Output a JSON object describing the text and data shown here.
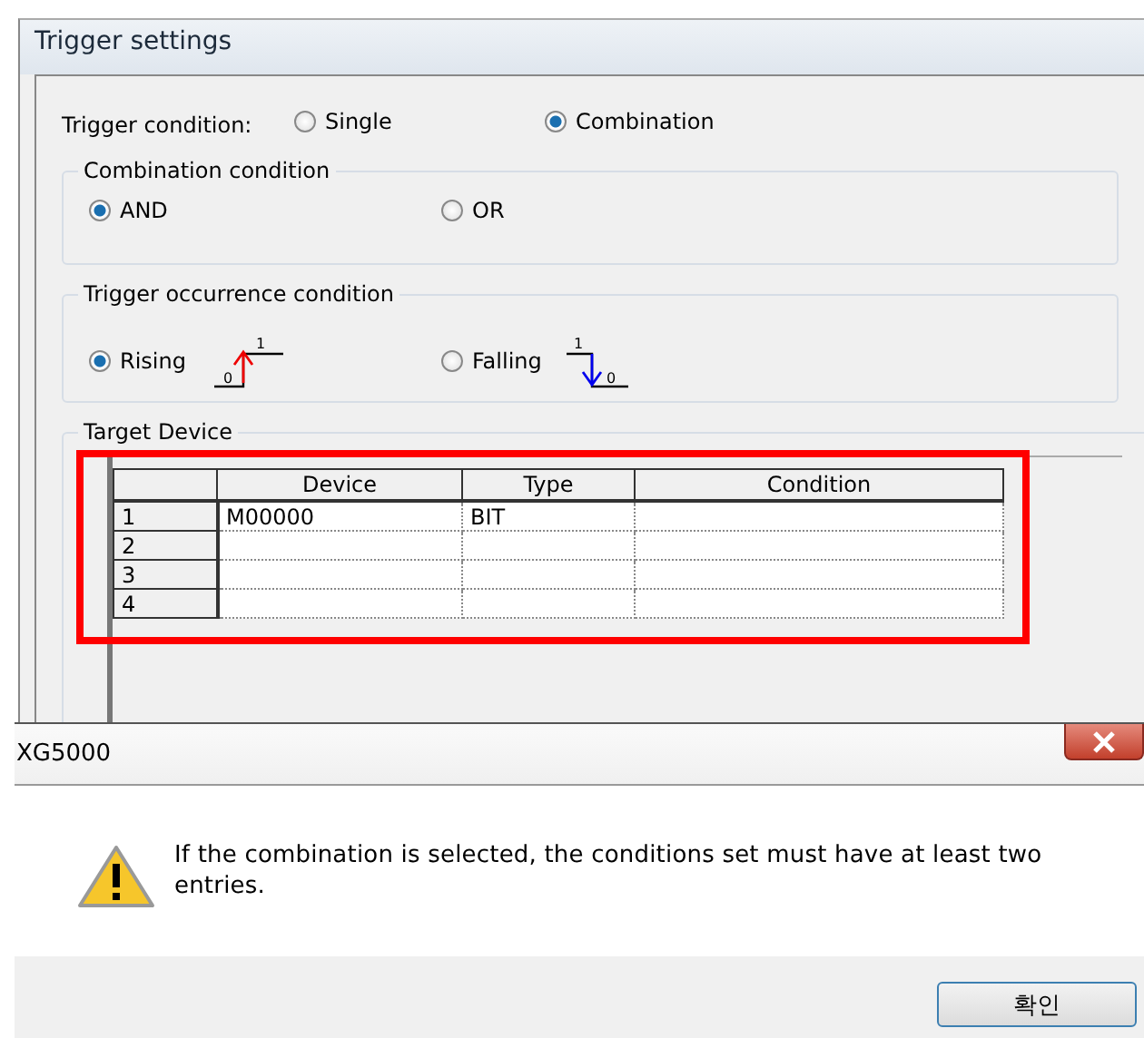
{
  "window": {
    "title": "Trigger settings"
  },
  "trigger_condition": {
    "label": "Trigger condition:",
    "options": [
      {
        "label": "Single",
        "selected": false
      },
      {
        "label": "Combination",
        "selected": true
      }
    ]
  },
  "combination_condition": {
    "title": "Combination condition",
    "options": [
      {
        "label": "AND",
        "selected": true
      },
      {
        "label": "OR",
        "selected": false
      }
    ]
  },
  "occurrence_condition": {
    "title": "Trigger occurrence condition",
    "options": [
      {
        "label": "Rising",
        "selected": true,
        "kind": "rising",
        "high": "1",
        "low": "0"
      },
      {
        "label": "Falling",
        "selected": false,
        "kind": "falling",
        "high": "1",
        "low": "0"
      }
    ]
  },
  "target_device": {
    "title": "Target Device",
    "table": {
      "columns": [
        "Device",
        "Type",
        "Condition"
      ],
      "rows": [
        {
          "number": "1",
          "device": "M00000",
          "type": "BIT"
        },
        {
          "number": "2"
        },
        {
          "number": "3"
        },
        {
          "number": "4"
        }
      ]
    }
  },
  "message_box": {
    "title": "XG5000",
    "message": "If the combination is selected, the conditions set must have at least two entries.",
    "buttons": [
      "확인"
    ]
  }
}
